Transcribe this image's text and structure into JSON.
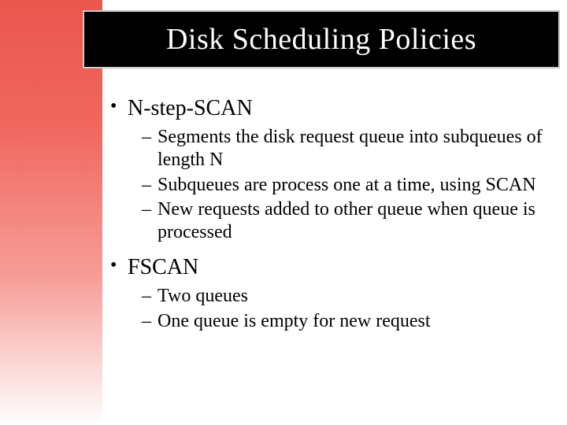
{
  "title": "Disk Scheduling Policies",
  "bullets": [
    {
      "label": "N-step-SCAN",
      "subs": [
        "Segments the disk request queue into subqueues of length N",
        "Subqueues are process one at a time, using SCAN",
        "New requests added to other queue when queue is processed"
      ]
    },
    {
      "label": "FSCAN",
      "subs": [
        "Two queues",
        "One queue is empty for new request"
      ]
    }
  ]
}
